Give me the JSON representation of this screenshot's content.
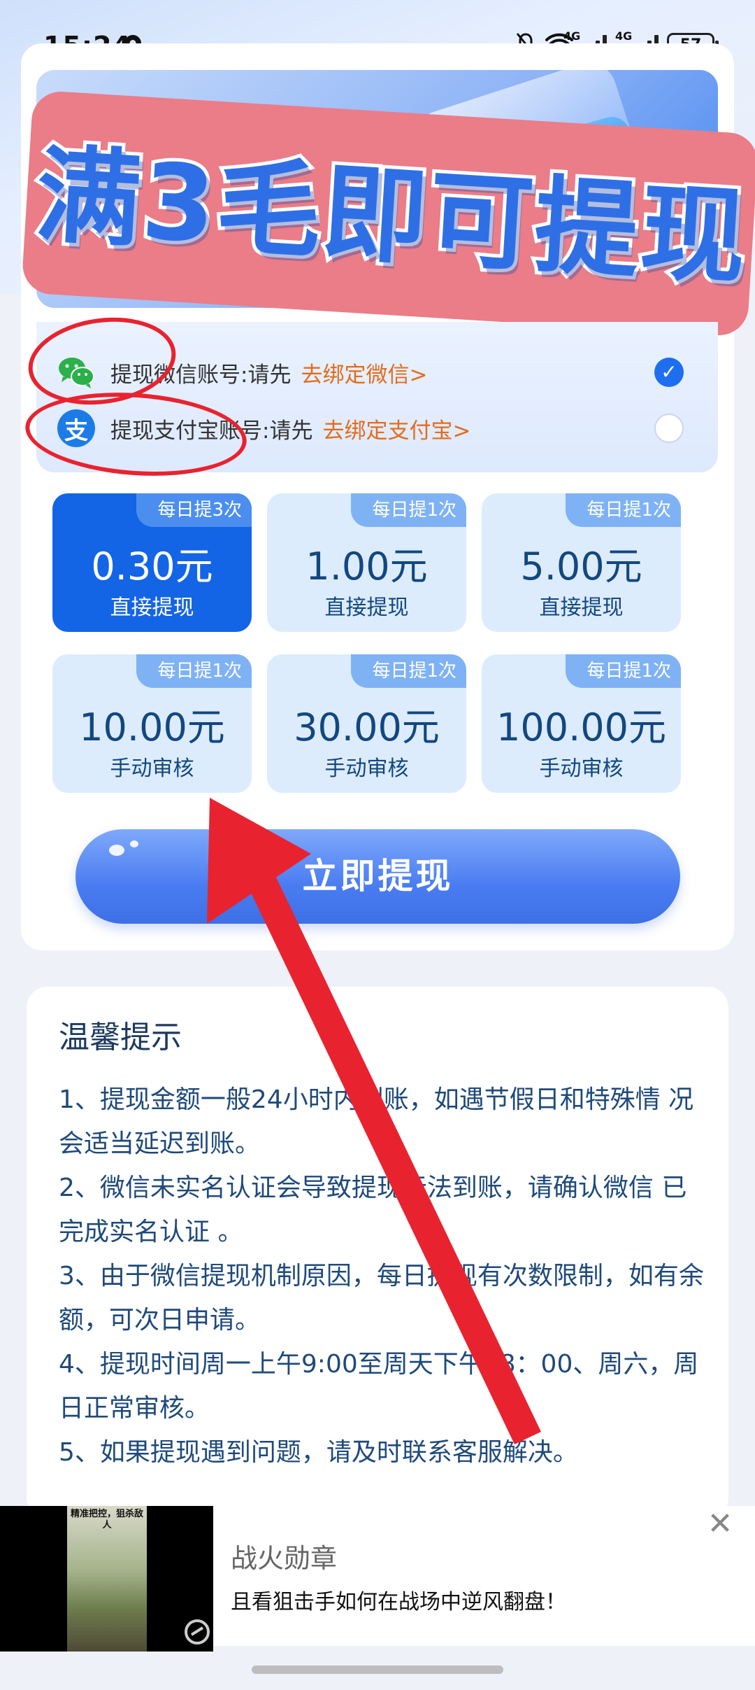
{
  "status_bar": {
    "time": "15:24",
    "network_1": "4G",
    "network_2": "4G",
    "battery": "57"
  },
  "banner": {
    "headline": "满3毛即可提现"
  },
  "accounts": [
    {
      "icon": "wechat-icon",
      "label": "提现微信账号:请先",
      "link": "去绑定微信>",
      "selected": true
    },
    {
      "icon": "alipay-icon",
      "icon_text": "支",
      "label": "提现支付宝账号:请先",
      "link": "去绑定支付宝>",
      "selected": false
    }
  ],
  "options": [
    {
      "tag": "每日提3次",
      "amount": "0.30元",
      "type": "直接提现",
      "active": true
    },
    {
      "tag": "每日提1次",
      "amount": "1.00元",
      "type": "直接提现",
      "active": false
    },
    {
      "tag": "每日提1次",
      "amount": "5.00元",
      "type": "直接提现",
      "active": false
    },
    {
      "tag": "每日提1次",
      "amount": "10.00元",
      "type": "手动审核",
      "active": false
    },
    {
      "tag": "每日提1次",
      "amount": "30.00元",
      "type": "手动审核",
      "active": false
    },
    {
      "tag": "每日提1次",
      "amount": "100.00元",
      "type": "手动审核",
      "active": false
    }
  ],
  "withdraw_button": "立即提现",
  "tips": {
    "title": "温馨提示",
    "items": [
      "1、提现金额一般24小时内到账，如遇节假日和特殊情 况会适当延迟到账。",
      "2、微信未实名认证会导致提现无法到账，请确认微信 已完成实名认证 。",
      "3、由于微信提现机制原因，每日提现有次数限制，如有余额，可次日申请。",
      "4、提现时间周一上午9:00至周天下午18：00、周六，周日正常审核。",
      "5、如果提现遇到问题，请及时联系客服解决。"
    ]
  },
  "ad": {
    "thumb_caption": "精准把控，狙杀敌人",
    "title": "战火勋章",
    "description": "且看狙击手如何在战场中逆风翻盘！",
    "close": "✕"
  },
  "colors": {
    "accent": "#1464e6",
    "link": "#e36c1d",
    "annotation": "#e8232f",
    "banner_pink": "#ea7d88"
  }
}
